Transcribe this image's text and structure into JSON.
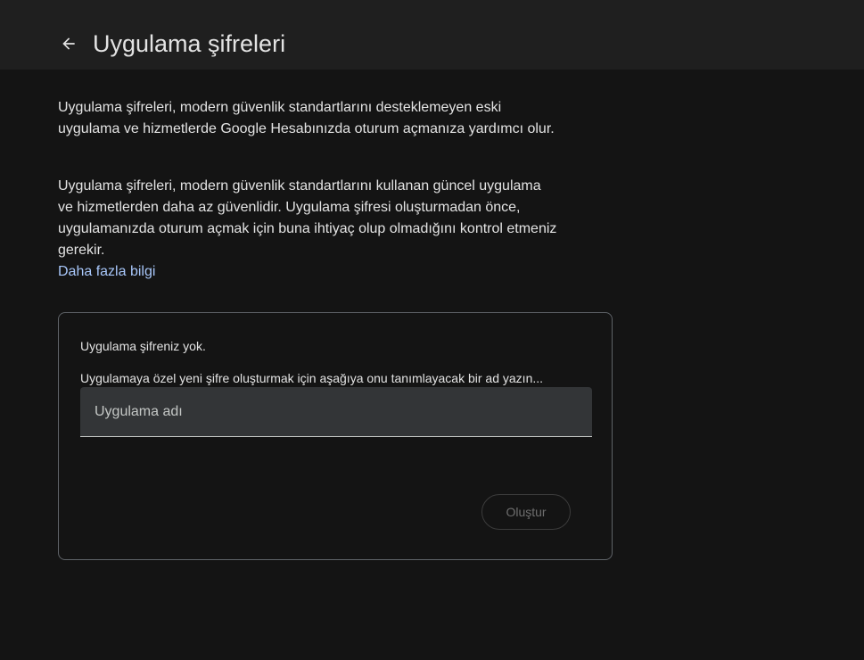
{
  "header": {
    "title": "Uygulama şifreleri",
    "back_icon": "arrow-back-icon"
  },
  "main": {
    "description_1": "Uygulama şifreleri, modern güvenlik standartlarını desteklemeyen eski uygulama ve hizmetlerde Google Hesabınızda oturum açmanıza yardımcı olur.",
    "description_2": "Uygulama şifreleri, modern güvenlik standartlarını kullanan güncel uygulama ve hizmetlerden daha az güvenlidir. Uygulama şifresi oluşturmadan önce, uygulamanızda oturum açmak için buna ihtiyaç olup olmadığını kontrol etmeniz gerekir.",
    "learn_more": "Daha fazla bilgi"
  },
  "card": {
    "status_text": "Uygulama şifreniz yok.",
    "instructions": "Uygulamaya özel yeni şifre oluşturmak için aşağıya onu tanımlayacak bir ad yazın...",
    "app_name_placeholder": "Uygulama adı",
    "app_name_value": "",
    "create_label": "Oluştur"
  },
  "colors": {
    "background": "#141414",
    "header": "#1f1f1f",
    "link": "#a8c7fa",
    "field": "#333537"
  }
}
